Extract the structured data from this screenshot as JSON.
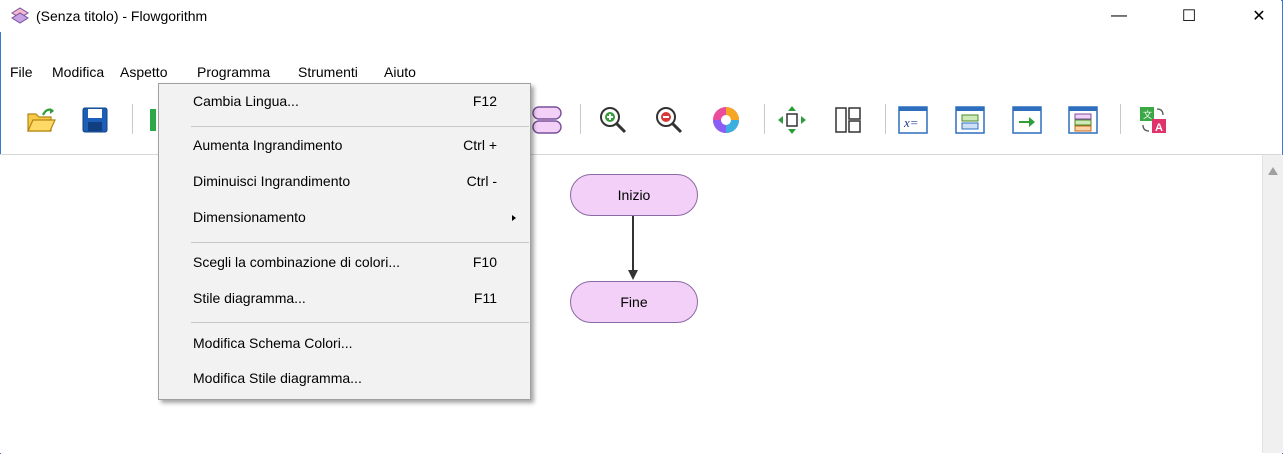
{
  "window": {
    "title": "(Senza titolo) - Flowgorithm",
    "minimize_glyph": "—",
    "maximize_glyph": "☐",
    "close_glyph": "✕"
  },
  "menubar": {
    "items": [
      "File",
      "Modifica",
      "Aspetto",
      "Programma",
      "Strumenti",
      "Aiuto"
    ]
  },
  "toolbar": {
    "icons": [
      "open-icon",
      "save-icon",
      "run-icon",
      "end-shape-icon",
      "zoom-in-icon",
      "zoom-out-icon",
      "color-scheme-icon",
      "dimension-icon",
      "layout-icon",
      "variable-watch-icon",
      "console-icon",
      "output-icon",
      "source-code-icon",
      "translate-icon"
    ]
  },
  "aspetto_menu": {
    "items": [
      {
        "label": "Cambia Lingua...",
        "shortcut": "F12"
      },
      {
        "label": "Aumenta Ingrandimento",
        "shortcut": "Ctrl +"
      },
      {
        "label": "Diminuisci Ingrandimento",
        "shortcut": "Ctrl -"
      },
      {
        "label": "Dimensionamento",
        "shortcut": ""
      },
      {
        "label": "Scegli la combinazione di colori...",
        "shortcut": "F10"
      },
      {
        "label": "Stile diagramma...",
        "shortcut": "F11"
      },
      {
        "label": "Modifica Schema Colori...",
        "shortcut": ""
      },
      {
        "label": "Modifica Stile diagramma...",
        "shortcut": ""
      }
    ]
  },
  "flowchart": {
    "start_label": "Inizio",
    "end_label": "Fine"
  },
  "colors": {
    "node_fill": "#f3d0f7",
    "node_border": "#8a6aa2",
    "window_border": "#3b78d1"
  }
}
